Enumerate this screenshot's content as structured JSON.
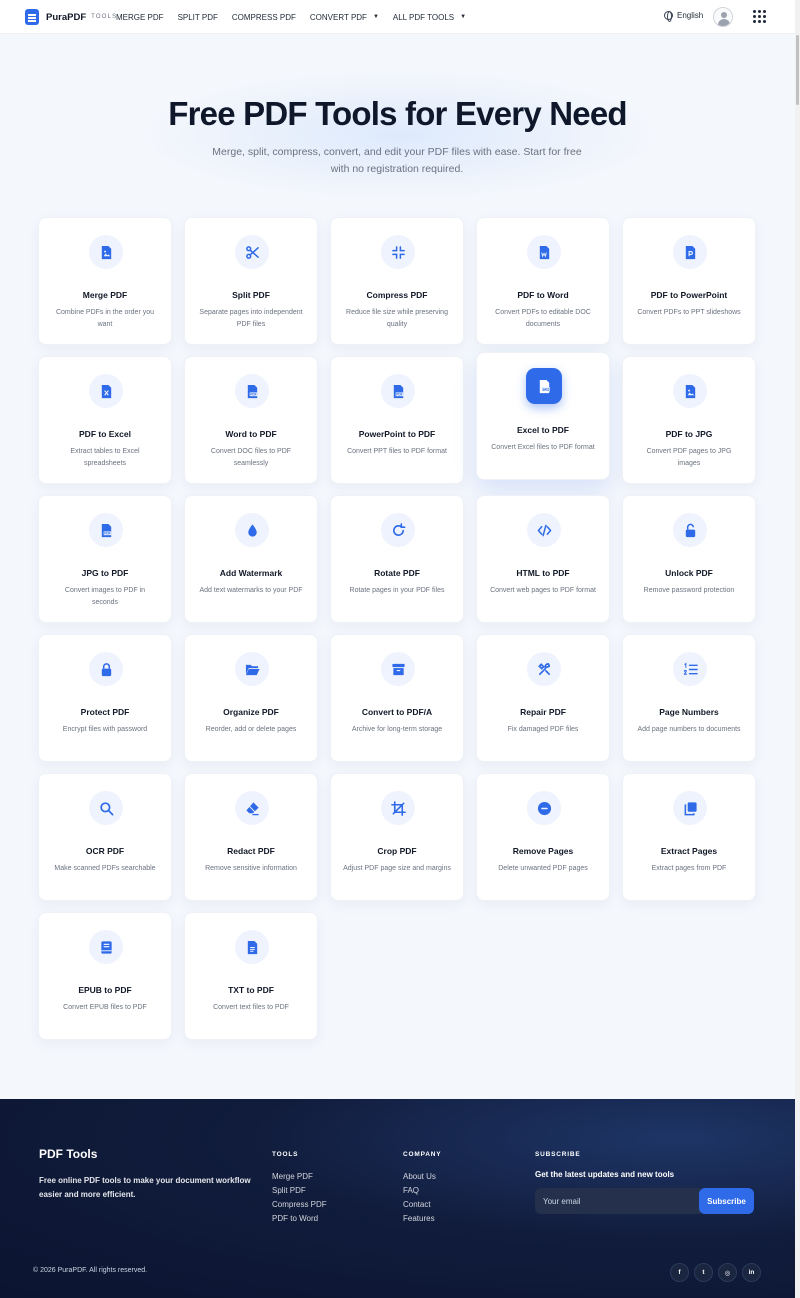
{
  "header": {
    "brand": "PuraPDF",
    "brand_sub": "TOOLS",
    "nav": [
      {
        "label": "MERGE PDF",
        "dropdown": false
      },
      {
        "label": "SPLIT PDF",
        "dropdown": false
      },
      {
        "label": "COMPRESS PDF",
        "dropdown": false
      },
      {
        "label": "CONVERT PDF",
        "dropdown": true
      },
      {
        "label": "ALL PDF TOOLS",
        "dropdown": true
      }
    ],
    "language": "English",
    "accent_color": "#2f6be8"
  },
  "hero": {
    "title": "Free PDF Tools for Every Need",
    "subtitle": "Merge, split, compress, convert, and edit your PDF files with ease. Start for free with no registration required."
  },
  "tools": [
    {
      "icon": "image-file-icon",
      "title": "Merge PDF",
      "desc": "Combine PDFs in the order you want"
    },
    {
      "icon": "scissors-icon",
      "title": "Split PDF",
      "desc": "Separate pages into independent PDF files"
    },
    {
      "icon": "compress-icon",
      "title": "Compress PDF",
      "desc": "Reduce file size while preserving quality"
    },
    {
      "icon": "word-file-icon",
      "title": "PDF to Word",
      "desc": "Convert PDFs to editable DOC documents"
    },
    {
      "icon": "powerpoint-file-icon",
      "title": "PDF to PowerPoint",
      "desc": "Convert PDFs to PPT slideshows"
    },
    {
      "icon": "excel-file-icon",
      "title": "PDF to Excel",
      "desc": "Extract tables to Excel spreadsheets"
    },
    {
      "icon": "pdf-file-icon",
      "title": "Word to PDF",
      "desc": "Convert DOC files to PDF seamlessly"
    },
    {
      "icon": "pdf-file-icon",
      "title": "PowerPoint to PDF",
      "desc": "Convert PPT files to PDF format"
    },
    {
      "icon": "pdf-file-icon",
      "title": "Excel to PDF",
      "desc": "Convert Excel files to PDF format",
      "active": true
    },
    {
      "icon": "image-file-icon",
      "title": "PDF to JPG",
      "desc": "Convert PDF pages to JPG images"
    },
    {
      "icon": "pdf-file-icon",
      "title": "JPG to PDF",
      "desc": "Convert images to PDF in seconds"
    },
    {
      "icon": "droplet-icon",
      "title": "Add Watermark",
      "desc": "Add text watermarks to your PDF"
    },
    {
      "icon": "rotate-icon",
      "title": "Rotate PDF",
      "desc": "Rotate pages in your PDF files"
    },
    {
      "icon": "code-icon",
      "title": "HTML to PDF",
      "desc": "Convert web pages to PDF format"
    },
    {
      "icon": "unlock-icon",
      "title": "Unlock PDF",
      "desc": "Remove password protection"
    },
    {
      "icon": "lock-icon",
      "title": "Protect PDF",
      "desc": "Encrypt files with password"
    },
    {
      "icon": "folder-open-icon",
      "title": "Organize PDF",
      "desc": "Reorder, add or delete pages"
    },
    {
      "icon": "archive-icon",
      "title": "Convert to PDF/A",
      "desc": "Archive for long-term storage"
    },
    {
      "icon": "tools-icon",
      "title": "Repair PDF",
      "desc": "Fix damaged PDF files"
    },
    {
      "icon": "numbered-list-icon",
      "title": "Page Numbers",
      "desc": "Add page numbers to documents"
    },
    {
      "icon": "search-icon",
      "title": "OCR PDF",
      "desc": "Make scanned PDFs searchable"
    },
    {
      "icon": "eraser-icon",
      "title": "Redact PDF",
      "desc": "Remove sensitive information"
    },
    {
      "icon": "crop-icon",
      "title": "Crop PDF",
      "desc": "Adjust PDF page size and margins"
    },
    {
      "icon": "minus-circle-icon",
      "title": "Remove Pages",
      "desc": "Delete unwanted PDF pages"
    },
    {
      "icon": "copy-icon",
      "title": "Extract Pages",
      "desc": "Extract pages from PDF"
    },
    {
      "icon": "book-icon",
      "title": "EPUB to PDF",
      "desc": "Convert EPUB files to PDF"
    },
    {
      "icon": "text-file-icon",
      "title": "TXT to PDF",
      "desc": "Convert text files to PDF"
    }
  ],
  "footer": {
    "brand": "PDF Tools",
    "tagline": "Free online PDF tools to make your document workflow easier and more efficient.",
    "tools_heading": "TOOLS",
    "tools_links": [
      "Merge PDF",
      "Split PDF",
      "Compress PDF",
      "PDF to Word"
    ],
    "company_heading": "COMPANY",
    "company_links": [
      "About Us",
      "FAQ",
      "Contact",
      "Features"
    ],
    "subscribe_heading": "SUBSCRIBE",
    "subscribe_text": "Get the latest updates and new tools",
    "email_placeholder": "Your email",
    "subscribe_button": "Subscribe",
    "copyright": "© 2026 PuraPDF. All rights reserved.",
    "socials": [
      {
        "icon": "facebook-icon",
        "glyph": "f"
      },
      {
        "icon": "twitter-icon",
        "glyph": "t"
      },
      {
        "icon": "instagram-icon",
        "glyph": "◎"
      },
      {
        "icon": "linkedin-icon",
        "glyph": "in"
      }
    ]
  }
}
